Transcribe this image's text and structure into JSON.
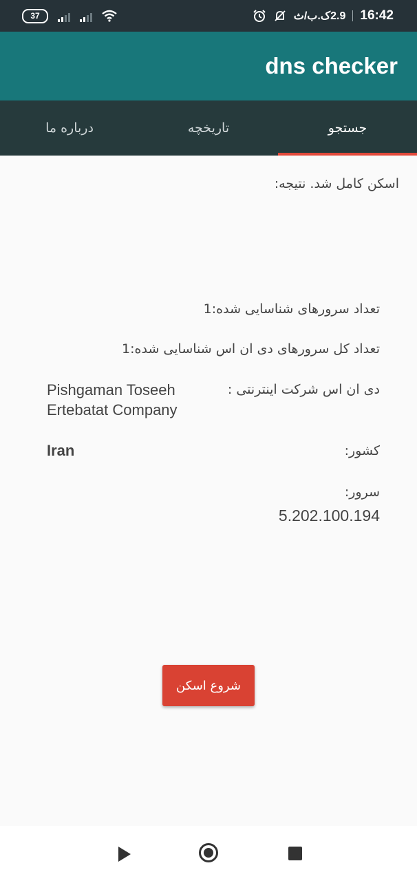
{
  "status_bar": {
    "time": "16:42",
    "speed": "2.9ک.ب/ث",
    "battery": "37",
    "icons": [
      "battery-icon",
      "signal-icon",
      "signal-icon",
      "wifi-icon",
      "alarm-icon",
      "notifications-off-icon"
    ]
  },
  "app": {
    "title": "dns checker"
  },
  "tabs": [
    {
      "label": "جستجو",
      "active": true
    },
    {
      "label": "تاریخچه",
      "active": false
    },
    {
      "label": "درباره ما",
      "active": false
    }
  ],
  "result": {
    "scan_status": "اسکن کامل شد. نتیجه:",
    "identified_servers": "تعداد سرورهای شناسایی شده:1",
    "total_dns_servers": "تعداد کل سرورهای دی ان اس شناسایی شده:1",
    "isp_label": "دی ان اس شرکت اینترنتی :",
    "isp_value_line1": "Pishgaman Toseeh",
    "isp_value_line2": "Ertebatat Company",
    "country_label": "کشور:",
    "country_value": "Iran",
    "server_label": "سرور:",
    "server_value": "5.202.100.194"
  },
  "actions": {
    "start_scan": "شروع اسکن"
  },
  "colors": {
    "status_bar": "#263238",
    "toolbar": "#18777a",
    "tab_bar": "#263a3c",
    "tab_indicator": "#e2493b",
    "button": "#d94233"
  },
  "navigation": [
    "back-icon",
    "home-icon",
    "recents-icon"
  ]
}
